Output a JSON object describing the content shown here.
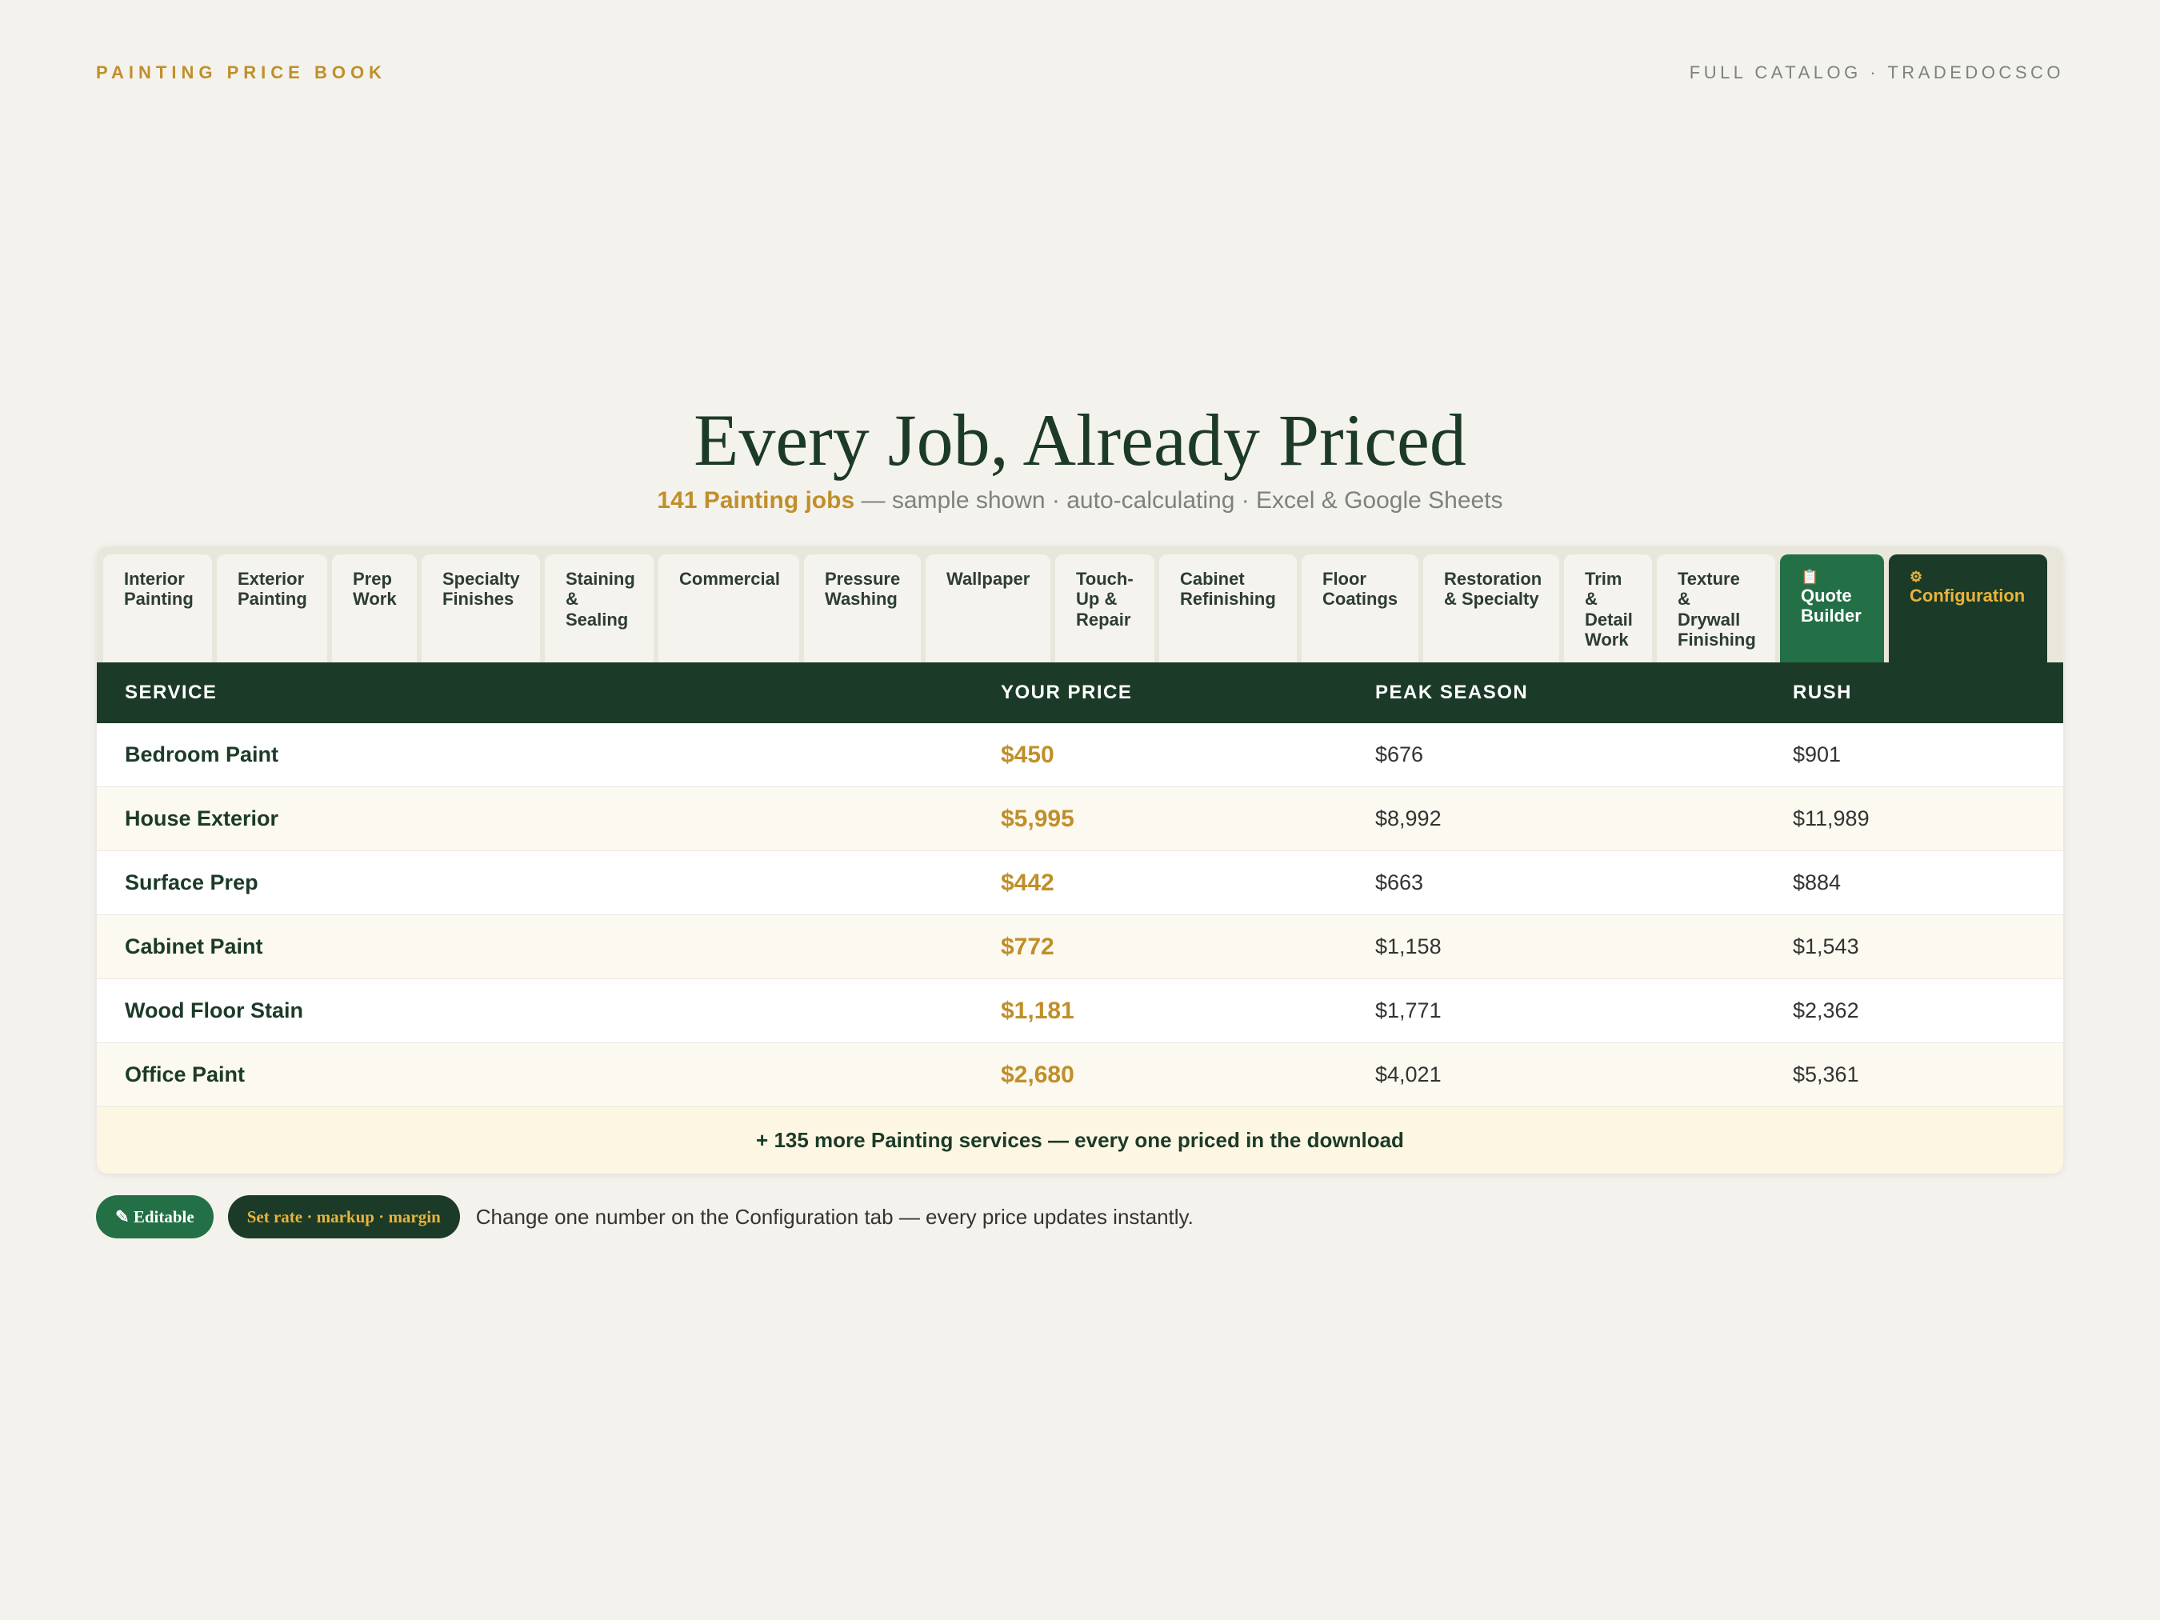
{
  "header": {
    "brand": "PAINTING PRICE BOOK",
    "catalog": "FULL CATALOG · TRADEDOCSCO"
  },
  "hero": {
    "title": "Every Job, Already Priced",
    "subtitle_highlight": "141 Painting jobs",
    "subtitle_rest": " — sample shown · auto-calculating · Excel & Google Sheets"
  },
  "tabs": [
    {
      "label": "Interior Painting",
      "width": 136
    },
    {
      "label": "Exterior Painting",
      "width": 138
    },
    {
      "label": "Prep Work",
      "width": 106
    },
    {
      "label": "Specialty Finishes",
      "width": 148
    },
    {
      "label": "Staining & Sealing",
      "width": 136
    },
    {
      "label": "Commercial",
      "width": 176
    },
    {
      "label": "Pressure Washing",
      "width": 146
    },
    {
      "label": "Wallpaper",
      "width": 156
    },
    {
      "label": "Touch-Up & Repair",
      "width": 124
    },
    {
      "label": "Cabinet Refinishing",
      "width": 172
    },
    {
      "label": "Floor Coatings",
      "width": 146
    },
    {
      "label": "Restoration & Specialty",
      "width": 170
    },
    {
      "label": "Trim & Detail Work",
      "width": 110
    },
    {
      "label": "Texture & Drywall Finishing",
      "width": 148
    }
  ],
  "quote_builder": {
    "icon": "📋",
    "label": "Quote Builder"
  },
  "configuration": {
    "icon": "⚙",
    "label": "Configuration"
  },
  "columns": {
    "service": "SERVICE",
    "your_price": "YOUR PRICE",
    "peak": "PEAK SEASON",
    "rush": "RUSH"
  },
  "rows": [
    {
      "service": "Bedroom Paint",
      "price": "$450",
      "peak": "$676",
      "rush": "$901"
    },
    {
      "service": "House Exterior",
      "price": "$5,995",
      "peak": "$8,992",
      "rush": "$11,989"
    },
    {
      "service": "Surface Prep",
      "price": "$442",
      "peak": "$663",
      "rush": "$884"
    },
    {
      "service": "Cabinet Paint",
      "price": "$772",
      "peak": "$1,158",
      "rush": "$1,543"
    },
    {
      "service": "Wood Floor Stain",
      "price": "$1,181",
      "peak": "$1,771",
      "rush": "$2,362"
    },
    {
      "service": "Office Paint",
      "price": "$2,680",
      "peak": "$4,021",
      "rush": "$5,361"
    }
  ],
  "more": "+ 135 more Painting services — every one priced in the download",
  "footer": {
    "editable": "✎ Editable",
    "set_rate": "Set rate · markup · margin",
    "note": "Change one number on the Configuration tab — every price updates instantly."
  },
  "colors": {
    "gold": "#c08f2a",
    "dark_green": "#1b3a28",
    "green": "#237047",
    "background": "#f4f2ec"
  }
}
